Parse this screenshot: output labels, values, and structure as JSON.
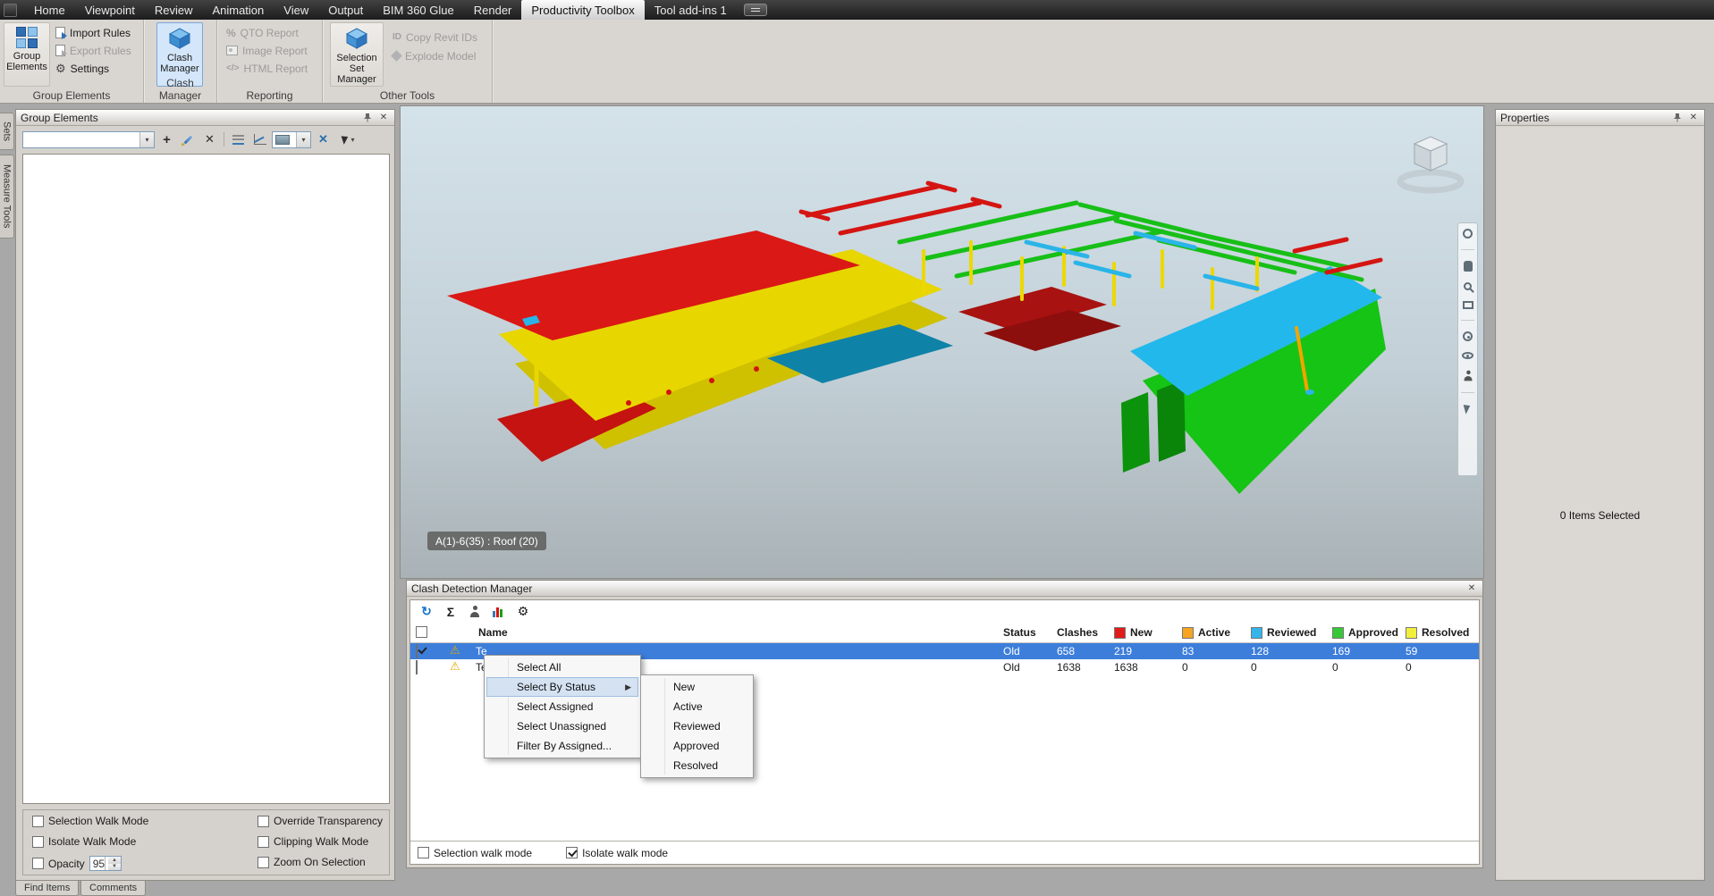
{
  "menubar": {
    "items": [
      "Home",
      "Viewpoint",
      "Review",
      "Animation",
      "View",
      "Output",
      "BIM 360 Glue",
      "Render",
      "Productivity Toolbox",
      "Tool add-ins 1"
    ],
    "active": "Productivity Toolbox"
  },
  "ribbon": {
    "groups": [
      {
        "label": "Group Elements"
      },
      {
        "label": "Clash Manager"
      },
      {
        "label": "Reporting"
      },
      {
        "label": "Other Tools"
      }
    ],
    "group_elements": {
      "big_button": "Group Elements",
      "import_rules": "Import Rules",
      "export_rules": "Export Rules",
      "settings": "Settings"
    },
    "clash_manager": {
      "big_button": "Clash Manager"
    },
    "reporting": {
      "qto": "QTO Report",
      "image": "Image Report",
      "html": "HTML Report"
    },
    "other_tools": {
      "big_button": "Selection Set Manager",
      "copy_ids": "Copy Revit IDs",
      "explode": "Explode Model"
    }
  },
  "side_tabs": {
    "sets": "Sets",
    "measure": "Measure Tools"
  },
  "group_panel": {
    "title": "Group Elements",
    "combo_value": "",
    "options": {
      "selection_walk": "Selection Walk Mode",
      "selection_walk_checked": false,
      "isolate_walk": "Isolate Walk Mode",
      "isolate_walk_checked": false,
      "opacity": "Opacity",
      "opacity_checked": false,
      "opacity_value": "95",
      "override_transparency": "Override Transparency",
      "override_transparency_checked": false,
      "clipping_walk": "Clipping Walk Mode",
      "clipping_walk_checked": false,
      "zoom_on_selection": "Zoom On Selection",
      "zoom_on_selection_checked": false
    },
    "tabs": [
      "Find Items",
      "Comments"
    ]
  },
  "viewport": {
    "tooltip": "A(1)-6(35) : Roof (20)"
  },
  "properties_panel": {
    "title": "Properties",
    "empty_text": "0 Items Selected"
  },
  "clash_panel": {
    "title": "Clash Detection Manager",
    "columns": {
      "name": "Name",
      "status": "Status",
      "clashes": "Clashes",
      "new": "New",
      "active": "Active",
      "reviewed": "Reviewed",
      "approved": "Approved",
      "resolved": "Resolved"
    },
    "rows": [
      {
        "checked": true,
        "selected": true,
        "name": "Te",
        "status": "Old",
        "clashes": "658",
        "new": "219",
        "active": "83",
        "reviewed": "128",
        "approved": "169",
        "resolved": "59"
      },
      {
        "checked": false,
        "selected": false,
        "name": "Te",
        "status": "Old",
        "clashes": "1638",
        "new": "1638",
        "active": "0",
        "reviewed": "0",
        "approved": "0",
        "resolved": "0"
      }
    ],
    "footer": {
      "selection_walk": "Selection walk mode",
      "selection_walk_checked": false,
      "isolate_walk": "Isolate walk mode",
      "isolate_walk_checked": true
    }
  },
  "context_menu": {
    "items": [
      "Select All",
      "Select By Status",
      "Select Assigned",
      "Select Unassigned",
      "Filter By Assigned..."
    ],
    "highlighted": "Select By Status",
    "submenu": [
      "New",
      "Active",
      "Reviewed",
      "Approved",
      "Resolved"
    ]
  },
  "colors": {
    "new": "#e11a1a",
    "active": "#f7a421",
    "reviewed": "#35b5ea",
    "approved": "#37c837",
    "resolved": "#f2ef3a",
    "selected_row": "#3d7edb"
  },
  "icons": {
    "close": "✕",
    "dropdown": "▾",
    "submenu_arrow": "▶",
    "gear": "⚙",
    "sigma": "Σ",
    "refresh": "↻",
    "warning": "⚠",
    "add": "+",
    "delete": "✕",
    "percent": "%",
    "html": "</>",
    "id": "ID",
    "up": "▲",
    "down": "▼"
  }
}
